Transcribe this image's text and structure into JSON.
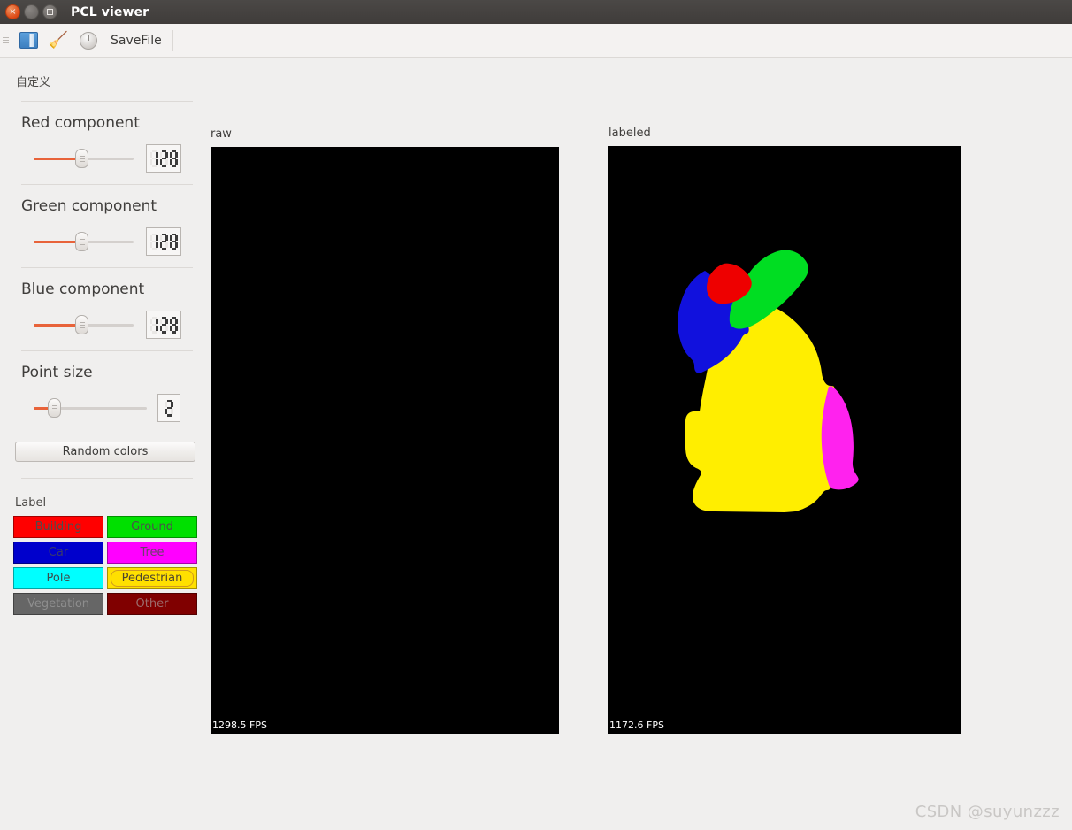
{
  "window": {
    "title": "PCL viewer",
    "controls": [
      {
        "name": "close",
        "glyph": "×"
      },
      {
        "name": "minimize",
        "glyph": "–"
      },
      {
        "name": "maximize",
        "glyph": "□"
      }
    ]
  },
  "toolbar": {
    "items": [
      {
        "icon": "open-file-icon",
        "label": ""
      },
      {
        "icon": "broom-icon",
        "label": "",
        "glyph": "🧹"
      },
      {
        "icon": "power-icon",
        "label": ""
      }
    ],
    "save_label": "SaveFile"
  },
  "sidebar": {
    "title": "自定义",
    "sliders": [
      {
        "name": "red-component",
        "label": "Red component",
        "value": "128",
        "digits": [
          "1",
          "2",
          "8"
        ],
        "fill_pct": 48
      },
      {
        "name": "green-component",
        "label": "Green component",
        "value": "128",
        "digits": [
          "1",
          "2",
          "8"
        ],
        "fill_pct": 48
      },
      {
        "name": "blue-component",
        "label": "Blue component",
        "value": "128",
        "digits": [
          "1",
          "2",
          "8"
        ],
        "fill_pct": 48
      },
      {
        "name": "point-size",
        "label": "Point size",
        "value": "2",
        "digits": [
          "2"
        ],
        "fill_pct": 18
      }
    ],
    "random_colors_label": "Random colors",
    "label_heading": "Label",
    "labels": [
      {
        "text": "Building",
        "bg": "#ff0000",
        "fg": "#4d4d4d",
        "focused": false
      },
      {
        "text": "Ground",
        "bg": "#00e000",
        "fg": "#4d4d4d",
        "focused": false
      },
      {
        "text": "Car",
        "bg": "#0000cc",
        "fg": "#3a3a6a",
        "focused": false
      },
      {
        "text": "Tree",
        "bg": "#ff00ff",
        "fg": "#6b3f6b",
        "focused": false
      },
      {
        "text": "Pole",
        "bg": "#00ffff",
        "fg": "#3c4d4d",
        "focused": false
      },
      {
        "text": "Pedestrian",
        "bg": "#ffe000",
        "fg": "#4d4430",
        "focused": true
      },
      {
        "text": "Vegetation",
        "bg": "#666666",
        "fg": "#8e8e8e",
        "focused": false
      },
      {
        "text": "Other",
        "bg": "#800000",
        "fg": "#9b6b6b",
        "focused": false
      }
    ]
  },
  "viewports": [
    {
      "name": "raw",
      "caption": "raw",
      "fps": "1298.5 FPS",
      "background": "#000000",
      "has_cloud": false
    },
    {
      "name": "labeled",
      "caption": "labeled",
      "fps": "1172.6 FPS",
      "background": "#000000",
      "has_cloud": true,
      "cloud_segments": [
        {
          "name": "red-segment",
          "color": "#ee0000",
          "label": "Building"
        },
        {
          "name": "green-segment",
          "color": "#00dd22",
          "label": "Ground"
        },
        {
          "name": "blue-segment",
          "color": "#1111dd",
          "label": "Car"
        },
        {
          "name": "yellow-segment",
          "color": "#ffee00",
          "label": "Pedestrian"
        },
        {
          "name": "magenta-segment",
          "color": "#ff22ee",
          "label": "Tree"
        }
      ]
    }
  ],
  "watermark": "CSDN @suyunzzz"
}
